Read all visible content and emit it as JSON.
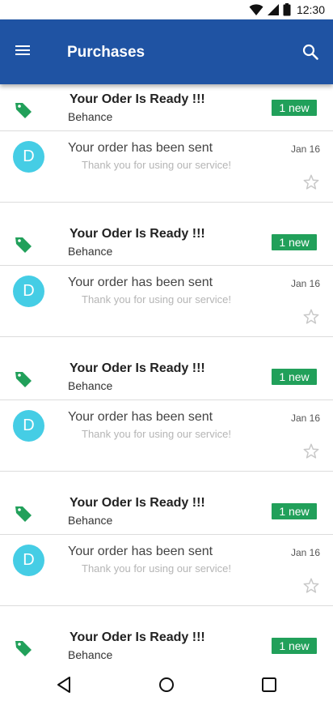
{
  "status_bar": {
    "time": "12:30",
    "icons": [
      "wifi-icon",
      "signal-icon",
      "battery-icon"
    ]
  },
  "app_bar": {
    "title": "Purchases",
    "menu_icon": "menu-icon",
    "search_icon": "search-icon",
    "color": "#1f53a3"
  },
  "colors": {
    "tag": "#21a05a",
    "badge": "#21a05a",
    "avatar": "#45cde5",
    "star": "#c8c8c8"
  },
  "groups": [
    {
      "title": "Your Oder Is Ready !!!",
      "sender": "Behance",
      "badge": "1 new",
      "message": {
        "avatar_letter": "D",
        "subject": "Your order has been sent",
        "preview": "Thank you for using our service!",
        "date": "Jan 16",
        "starred": false
      }
    },
    {
      "title": "Your Oder Is Ready !!!",
      "sender": "Behance",
      "badge": "1 new",
      "message": {
        "avatar_letter": "D",
        "subject": "Your order has been sent",
        "preview": "Thank you for using our service!",
        "date": "Jan 16",
        "starred": false
      }
    },
    {
      "title": "Your Oder Is Ready !!!",
      "sender": "Behance",
      "badge": "1 new",
      "message": {
        "avatar_letter": "D",
        "subject": "Your order has been sent",
        "preview": "Thank you for using our service!",
        "date": "Jan 16",
        "starred": false
      }
    },
    {
      "title": "Your Oder Is Ready !!!",
      "sender": "Behance",
      "badge": "1 new",
      "message": {
        "avatar_letter": "D",
        "subject": "Your order has been sent",
        "preview": "Thank you for using our service!",
        "date": "Jan 16",
        "starred": false
      }
    },
    {
      "title": "Your Oder Is Ready !!!",
      "sender": "Behance",
      "badge": "1 new",
      "message": null
    }
  ],
  "nav_bar": {
    "buttons": [
      "back-icon",
      "home-icon",
      "recents-icon"
    ]
  }
}
